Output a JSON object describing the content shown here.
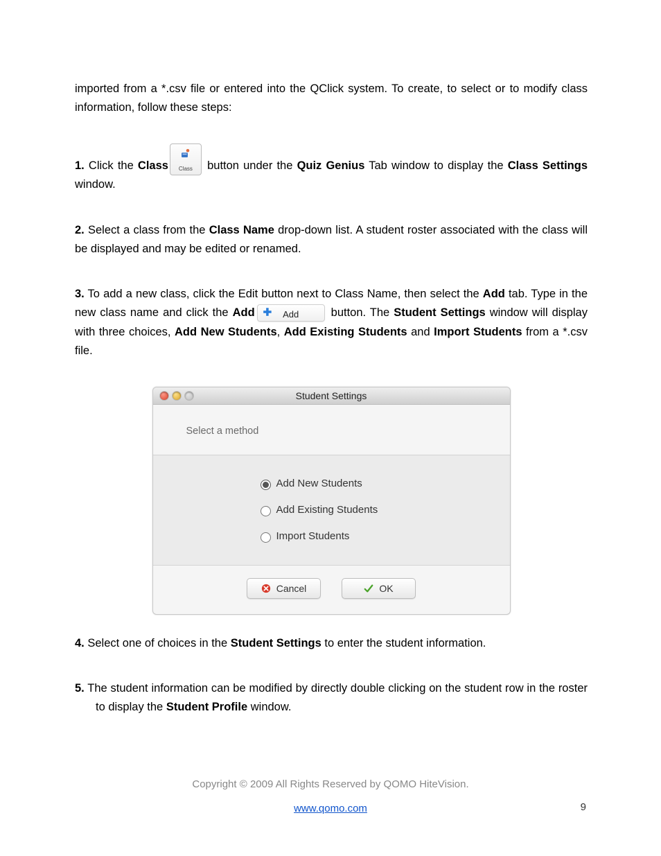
{
  "intro_paragraph": "imported from a *.csv file or entered into the QClick system. To create, to select or to modify class information, follow these steps:",
  "step1": {
    "num": "1.",
    "pre": " Click the ",
    "bold_class": "Class",
    "icon_label": "Class",
    "mid": " button under the ",
    "bold_quiz": "Quiz Genius",
    "mid2": " Tab window to display the ",
    "bold_cs": "Class Settings",
    "end": " window."
  },
  "step2": {
    "num": "2.",
    "pre": " Select a class from the ",
    "bold_cn": "Class Name",
    "post": " drop-down list. A student roster associated with the class will be displayed and may be edited or renamed."
  },
  "step3": {
    "num": "3.",
    "pre": " To add a new class, click the Edit button next to Class Name, then select the ",
    "bold_add_tab": "Add",
    "mid": " tab. Type in the new class name and click the ",
    "bold_add": "Add",
    "add_btn_label": "Add",
    "mid2": " button. The ",
    "bold_ss": "Student Settings",
    "mid3": " window will display with three choices, ",
    "bold_ans": "Add New Students",
    "sep1": ", ",
    "bold_aes": "Add Existing Students",
    "sep2": " and ",
    "bold_is": "Import Students",
    "end": " from a *.csv file."
  },
  "dialog": {
    "title": "Student Settings",
    "select_method": "Select a method",
    "opt1": "Add New Students",
    "opt2": "Add Existing Students",
    "opt3": "Import Students",
    "cancel": "Cancel",
    "ok": "OK"
  },
  "step4": {
    "num": "4.",
    "pre": "   Select one of choices in the ",
    "bold_ss": "Student Settings",
    "post": " to enter the student information."
  },
  "step5": {
    "num": "5.",
    "pre": "   The student information can be modified by directly double clicking on the student row in the roster to display the ",
    "bold_sp": "Student Profile",
    "post": " window."
  },
  "footer": {
    "copyright": "Copyright © 2009 All Rights Reserved by QOMO HiteVision.",
    "link": "www.qomo.com"
  },
  "page_number": "9"
}
